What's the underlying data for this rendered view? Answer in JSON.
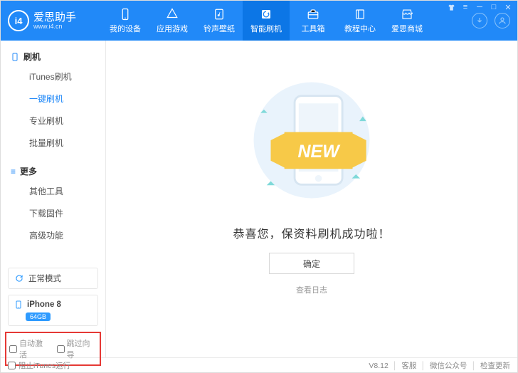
{
  "brand": {
    "name": "爱思助手",
    "sub": "www.i4.cn",
    "logo_text": "i4"
  },
  "nav": {
    "items": [
      {
        "label": "我的设备",
        "icon": "phone"
      },
      {
        "label": "应用游戏",
        "icon": "apps"
      },
      {
        "label": "铃声壁纸",
        "icon": "music"
      },
      {
        "label": "智能刷机",
        "icon": "refresh",
        "active": true
      },
      {
        "label": "工具箱",
        "icon": "toolbox"
      },
      {
        "label": "教程中心",
        "icon": "book"
      },
      {
        "label": "爱思商城",
        "icon": "store"
      }
    ]
  },
  "sidebar": {
    "groups": [
      {
        "title": "刷机",
        "icon": "phone",
        "items": [
          "iTunes刷机",
          "一键刷机",
          "专业刷机",
          "批量刷机"
        ],
        "activeIndex": 1
      },
      {
        "title": "更多",
        "icon": "menu",
        "items": [
          "其他工具",
          "下载固件",
          "高级功能"
        ],
        "activeIndex": -1
      }
    ],
    "mode_label": "正常模式",
    "device": {
      "name": "iPhone 8",
      "storage": "64GB"
    },
    "checkboxes": {
      "auto_activate": "自动激活",
      "skip_wizard": "跳过向导"
    }
  },
  "main": {
    "banner_text": "NEW",
    "success_message": "恭喜您，保资料刷机成功啦！",
    "confirm_label": "确定",
    "view_log_label": "查看日志"
  },
  "footer": {
    "block_itunes_label": "阻止iTunes运行",
    "version": "V8.12",
    "links": [
      "客服",
      "微信公众号",
      "检查更新"
    ]
  }
}
